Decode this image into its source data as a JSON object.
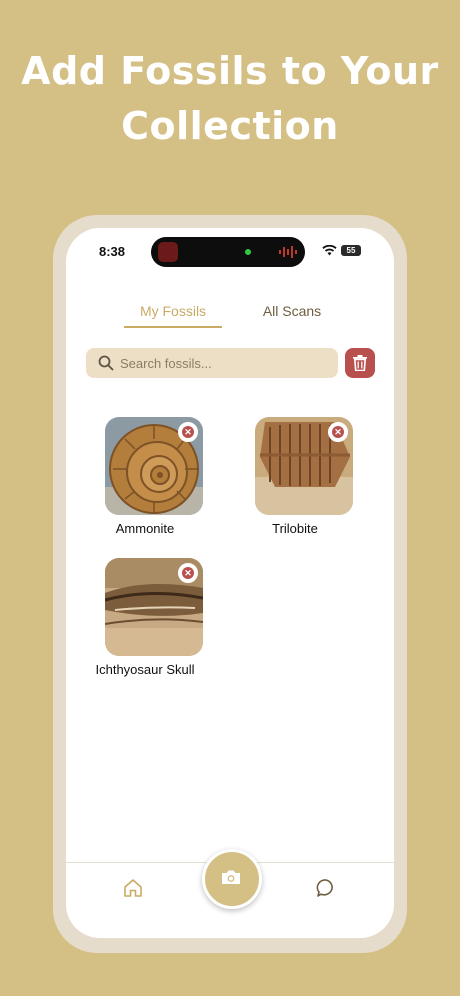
{
  "headline": {
    "line1": "Add Fossils to Your",
    "line2": "Collection"
  },
  "status_bar": {
    "time": "8:38",
    "battery": "55"
  },
  "tabs": [
    {
      "label": "My Fossils",
      "active": true
    },
    {
      "label": "All Scans",
      "active": false
    }
  ],
  "search": {
    "placeholder": "Search fossils..."
  },
  "icons": {
    "search": "search-icon",
    "trash": "trash-icon",
    "remove": "close-icon",
    "home": "home-icon",
    "camera": "camera-icon",
    "chat": "chat-icon"
  },
  "fossils": [
    {
      "name": "Ammonite"
    },
    {
      "name": "Trilobite"
    },
    {
      "name": "Ichthyosaur Skull"
    }
  ],
  "colors": {
    "background": "#d4bf85",
    "accent": "#c9ab64",
    "danger": "#b8504d",
    "search_bg": "#ecdfc6"
  }
}
